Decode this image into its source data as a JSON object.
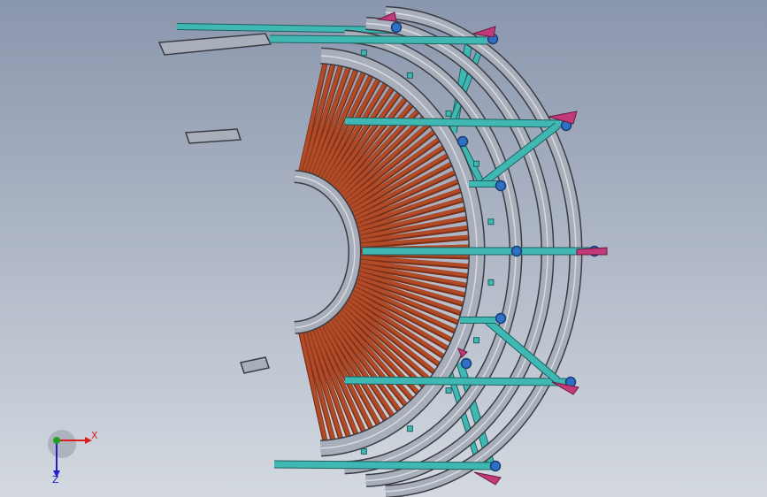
{
  "viewport": {
    "background_top": "#8a96ad",
    "background_bottom": "#d4d9e0"
  },
  "model": {
    "roller_count": 60,
    "roller_color": "#b04a27",
    "roller_shadow": "#7a2f16",
    "rail_color": "#a9aebb",
    "rail_edge": "#3a3c44",
    "frame_color": "#3fb8b4",
    "frame_edge": "#1f5f5d",
    "foot_color": "#c23a7a",
    "caster_color": "#2f6fc4"
  },
  "triad": {
    "x_label": "X",
    "z_label": "Z",
    "x_color": "#d62020",
    "y_color": "#20a020",
    "z_color": "#2020c8"
  }
}
